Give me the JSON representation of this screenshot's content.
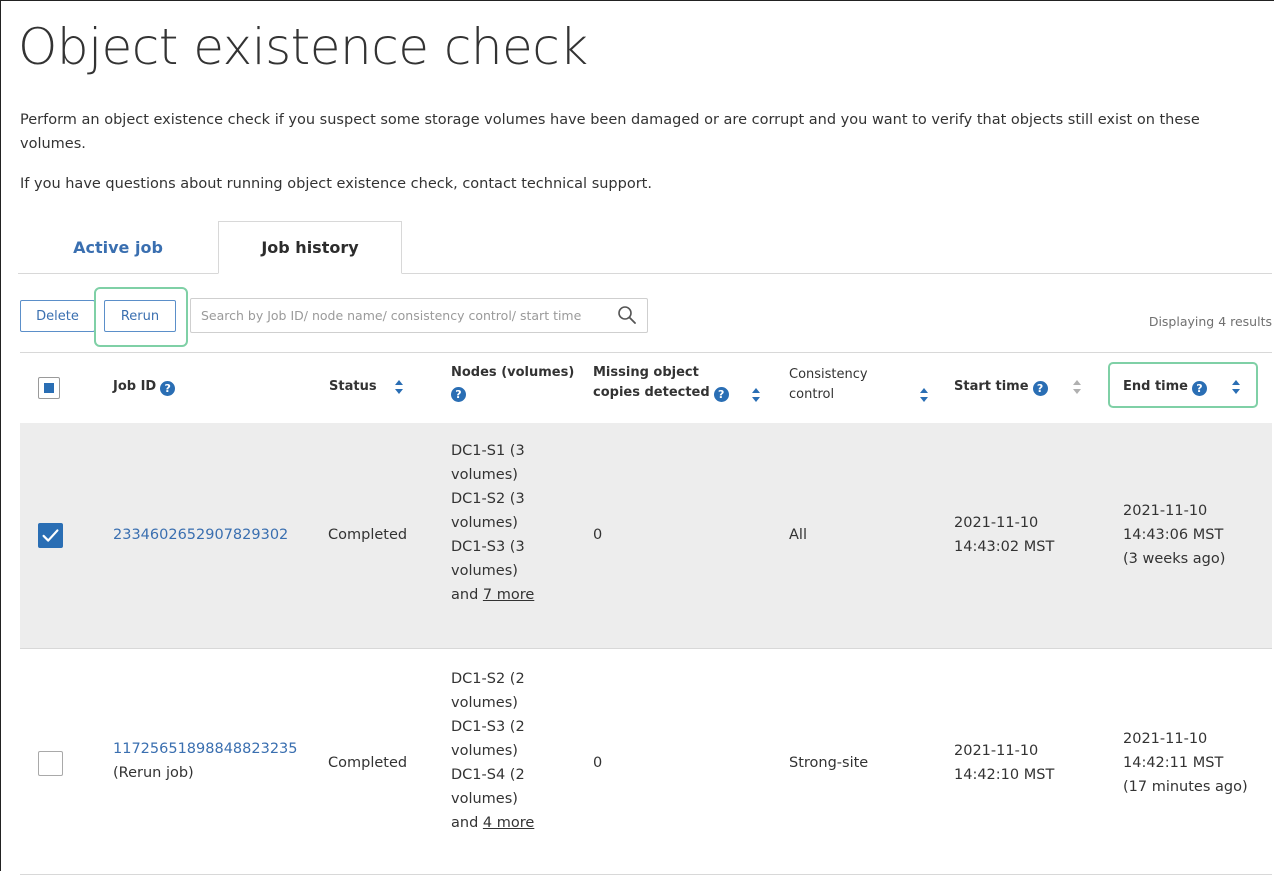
{
  "page": {
    "title": "Object existence check",
    "description": "Perform an object existence check if you suspect some storage volumes have been damaged or are corrupt and you want to verify that objects still exist on these volumes.",
    "support_note": "If you have questions about running object existence check, contact technical support."
  },
  "tabs": [
    {
      "label": "Active job",
      "active": false
    },
    {
      "label": "Job history",
      "active": true
    }
  ],
  "toolbar": {
    "delete_label": "Delete",
    "rerun_label": "Rerun",
    "search_placeholder": "Search by Job ID/ node name/ consistency control/ start time",
    "results_text": "Displaying 4 results"
  },
  "table": {
    "columns": {
      "job_id": "Job ID",
      "status": "Status",
      "nodes_line1": "Nodes (volumes)",
      "missing_line1": "Missing object",
      "missing_line2": "copies detected",
      "consistency_line1": "Consistency",
      "consistency_line2": "control",
      "start_time": "Start time",
      "end_time": "End time"
    },
    "rows": [
      {
        "selected": true,
        "job_id": "2334602652907829302",
        "job_note": "",
        "status": "Completed",
        "nodes": [
          "DC1-S1 (3",
          "volumes)",
          "DC1-S2 (3",
          "volumes)",
          "DC1-S3 (3",
          "volumes)"
        ],
        "nodes_more_prefix": "and ",
        "nodes_more_link": "7 more",
        "missing": "0",
        "consistency": "All",
        "start_date": "2021-11-10",
        "start_time": "14:43:02 MST",
        "end_date": "2021-11-10",
        "end_time": "14:43:06 MST",
        "end_relative": "(3 weeks ago)"
      },
      {
        "selected": false,
        "job_id": "11725651898848823235",
        "job_note": "(Rerun job)",
        "status": "Completed",
        "nodes": [
          "DC1-S2 (2",
          "volumes)",
          "DC1-S3 (2",
          "volumes)",
          "DC1-S4 (2",
          "volumes)"
        ],
        "nodes_more_prefix": "and ",
        "nodes_more_link": "4 more",
        "missing": "0",
        "consistency": "Strong-site",
        "start_date": "2021-11-10",
        "start_time": "14:42:10 MST",
        "end_date": "2021-11-10",
        "end_time": "14:42:11 MST",
        "end_relative": "(17 minutes ago)"
      }
    ]
  },
  "icons": {
    "help": "?",
    "sort": "sort-icon",
    "search": "search-icon",
    "check": "checkmark-icon"
  },
  "colors": {
    "accent": "#2a6eb4",
    "link": "#3a6fb0",
    "highlight": "#7fd0a6",
    "selected_row": "#ededed"
  }
}
